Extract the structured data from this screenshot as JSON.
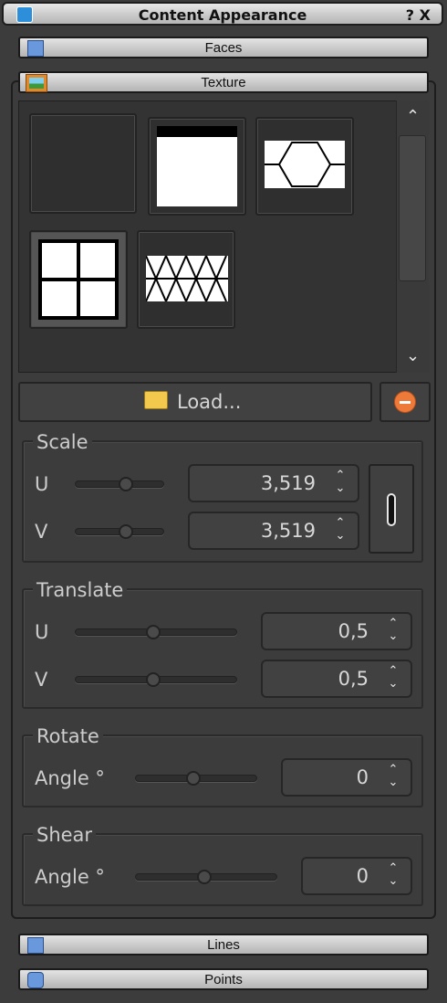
{
  "window": {
    "title": "Content Appearance",
    "help_label": "?",
    "close_label": "X"
  },
  "sections": {
    "faces": "Faces",
    "texture": "Texture",
    "lines": "Lines",
    "points": "Points"
  },
  "texture": {
    "thumbnails": [
      "none",
      "top-bar",
      "hexagon",
      "grid-2x2",
      "triangles"
    ],
    "selected_index": 4,
    "load_label": "Load..."
  },
  "scale": {
    "title": "Scale",
    "u_label": "U",
    "u_value": "3,519",
    "v_label": "V",
    "v_value": "3,519"
  },
  "translate": {
    "title": "Translate",
    "u_label": "U",
    "u_value": "0,5",
    "v_label": "V",
    "v_value": "0,5"
  },
  "rotate": {
    "title": "Rotate",
    "angle_label": "Angle °",
    "angle_value": "0"
  },
  "shear": {
    "title": "Shear",
    "angle_label": "Angle °",
    "angle_value": "0"
  },
  "colors": {
    "accent": "#2d8fd9",
    "panel_bg": "#3c3c3c",
    "clear_button": "#ee7a3a",
    "folder": "#f2c94c"
  }
}
